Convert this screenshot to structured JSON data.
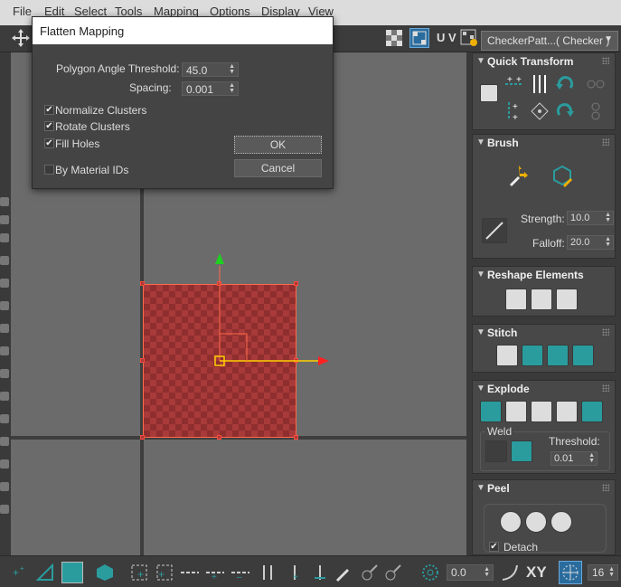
{
  "menubar": {
    "items": [
      "File",
      "Edit",
      "Select",
      "Tools",
      "Mapping",
      "Options",
      "Display",
      "View"
    ]
  },
  "toolbar": {
    "uv_label": "U V",
    "texture_dropdown": "CheckerPatt...( Checker )"
  },
  "dialog": {
    "title": "Flatten Mapping",
    "polygon_angle_label": "Polygon Angle Threshold:",
    "polygon_angle_value": "45.0",
    "spacing_label": "Spacing:",
    "spacing_value": "0.001",
    "normalize_clusters": {
      "label": "Normalize Clusters",
      "checked": true
    },
    "rotate_clusters": {
      "label": "Rotate Clusters",
      "checked": true
    },
    "fill_holes": {
      "label": "Fill Holes",
      "checked": true
    },
    "by_material_ids": {
      "label": "By Material IDs",
      "checked": false
    },
    "ok_label": "OK",
    "cancel_label": "Cancel"
  },
  "panel": {
    "quick_transform": {
      "title": "Quick Transform"
    },
    "brush": {
      "title": "Brush",
      "strength_label": "Strength:",
      "strength_value": "10.0",
      "falloff_label": "Falloff:",
      "falloff_value": "20.0"
    },
    "reshape": {
      "title": "Reshape Elements"
    },
    "stitch": {
      "title": "Stitch"
    },
    "explode": {
      "title": "Explode",
      "weld_label": "Weld",
      "threshold_label": "Threshold:",
      "threshold_value": "0.01"
    },
    "peel": {
      "title": "Peel",
      "detach_label": "Detach",
      "detach_checked": true
    }
  },
  "bottombar": {
    "offset_value": "0.0",
    "xy_label": "XY",
    "grid_value": "16"
  },
  "colors": {
    "accent_teal": "#2a9c9e",
    "uv_face": "#a83a3a",
    "gizmo_x": "#ff2020",
    "gizmo_y": "#20d020",
    "gizmo_axis": "#ffd000"
  }
}
